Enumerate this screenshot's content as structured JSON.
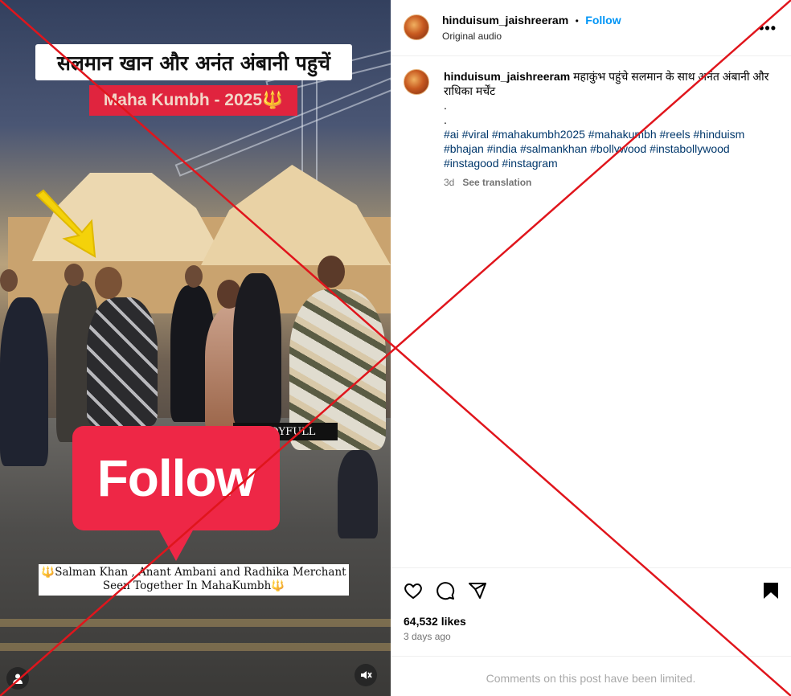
{
  "media": {
    "overlay_title": "सलमान खान और अनंत अंबानी पहुचें",
    "overlay_event": "Maha Kumbh - 2025🔱",
    "watermark": "S JOYFULL",
    "follow_sticker": "Follow",
    "caption_line1": "🔱Salman Khan , Anant Ambani and Radhika Merchant",
    "caption_line2": "Seen Together In MahaKumbh🔱",
    "icons": {
      "mute": "volume-muted-icon",
      "tag": "user-tag-icon"
    }
  },
  "post_header": {
    "username": "hinduisum_jaishreeram",
    "separator": "•",
    "follow_label": "Follow",
    "audio": "Original audio",
    "more": "•••"
  },
  "caption": {
    "username": "hinduisum_jaishreeram",
    "text": "महाकुंभ पहुंचे सलमान के साथ अनंत अंबानी और राधिका मर्चेंट",
    "dot1": ".",
    "dot2": ".",
    "hashtags": "#ai #viral #mahakumbh2025 #mahakumbh #reels #hinduism #bhajan #india #salmankhan #bollywood #instabollywood #instagood #instagram",
    "age": "3d",
    "see_translation": "See translation"
  },
  "actions": {
    "likes": "64,532 likes",
    "posted": "3 days ago",
    "comments_limited": "Comments on this post have been limited."
  },
  "colors": {
    "link": "#0095f6",
    "hashtag": "#00376b",
    "sticker_red": "#ee2746",
    "cross_red": "#e0151c"
  }
}
